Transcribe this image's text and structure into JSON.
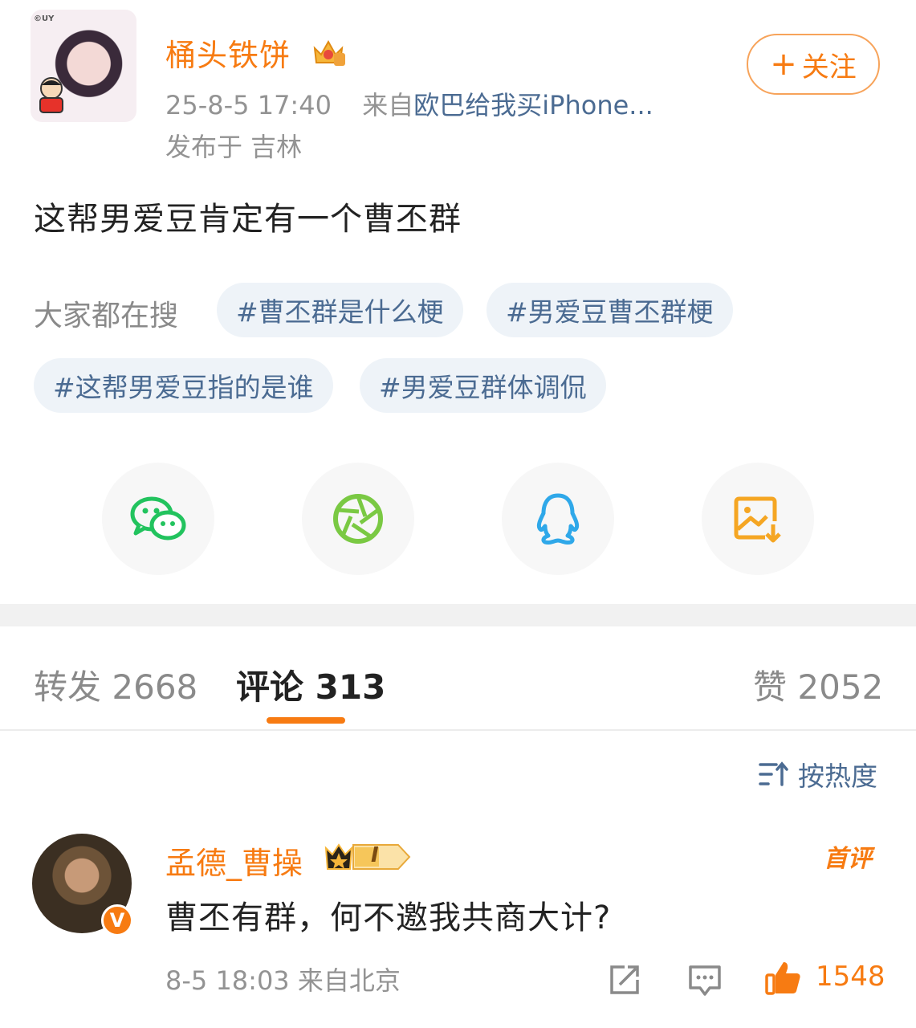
{
  "post": {
    "author": "桶头铁饼",
    "time": "25-8-5 17:40",
    "source_prefix": "来自",
    "source": "欧巴给我买iPhone...",
    "location": "发布于 吉林",
    "follow_label": "关注",
    "follow_plus": "+",
    "text": "这帮男爱豆肯定有一个曹丕群",
    "avatar_badge": "©UY"
  },
  "trending": {
    "label": "大家都在搜",
    "tags": [
      "#曹丕群是什么梗",
      "#男爱豆曹丕群梗",
      "#这帮男爱豆指的是谁",
      "#男爱豆群体调侃"
    ]
  },
  "share": {
    "icons": [
      "wechat-icon",
      "moments-icon",
      "qq-icon",
      "save-image-icon"
    ],
    "colors": {
      "wechat": "#22c35e",
      "moments": "#7ac943",
      "qq": "#2fa8e9",
      "save": "#f5a623"
    }
  },
  "tabs": {
    "repost_label": "转发",
    "repost_count": "2668",
    "comment_label": "评论",
    "comment_count": "313",
    "like_label": "赞",
    "like_count": "2052"
  },
  "sort": {
    "label": "按热度"
  },
  "comment": {
    "author": "孟德_曹操",
    "badge_level": "I",
    "first_tag": "首评",
    "text": "曹丕有群，何不邀我共商大计?",
    "time": "8-5 18:03",
    "location": "来自北京",
    "like_count": "1548",
    "verified": "V"
  },
  "colors": {
    "accent": "#f77b12",
    "link": "#4b6b92",
    "muted": "#939393"
  }
}
